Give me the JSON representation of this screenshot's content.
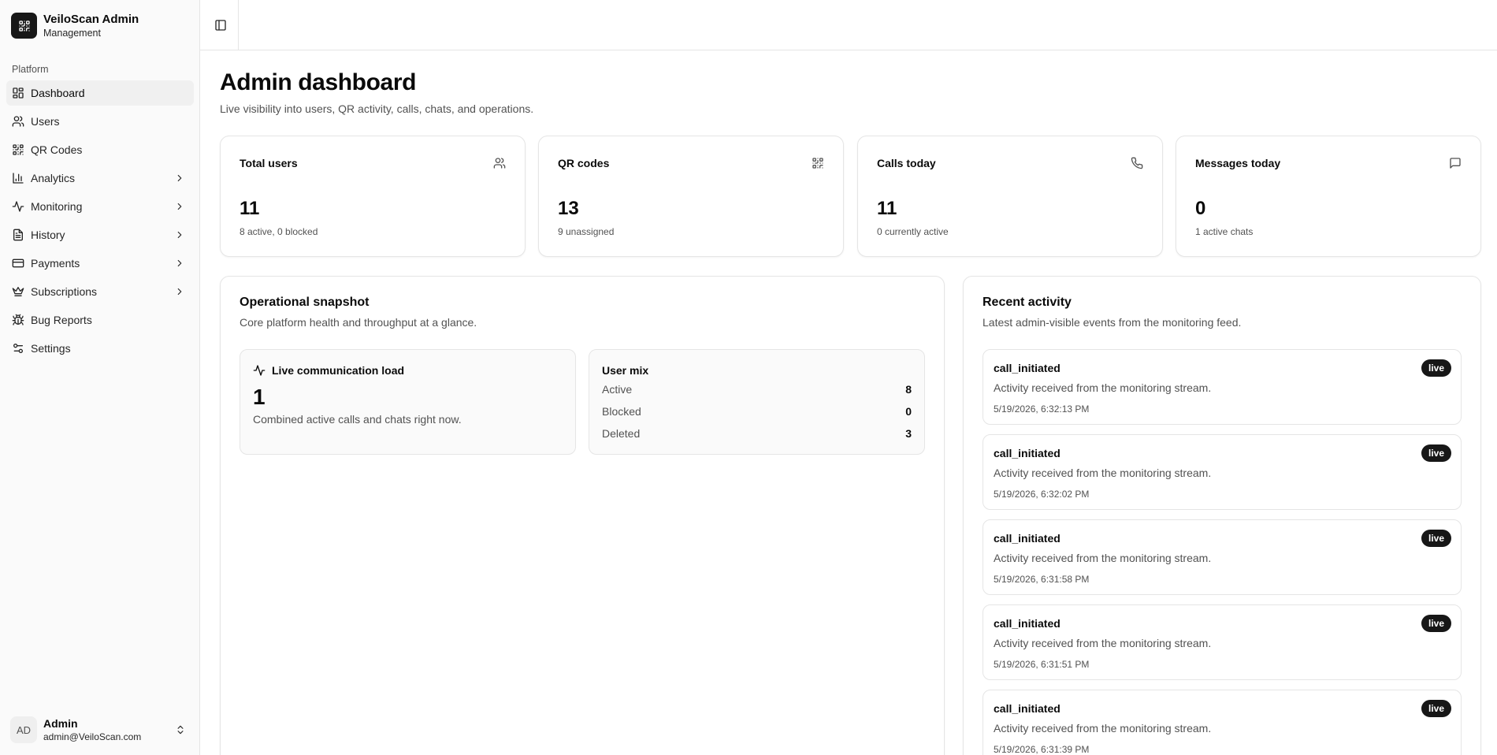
{
  "sidebar": {
    "brand_title": "VeiloScan Admin",
    "brand_subtitle": "Management",
    "group_label": "Platform",
    "items": [
      {
        "label": "Dashboard",
        "icon": "layout-dashboard-icon",
        "active": true,
        "has_submenu": false
      },
      {
        "label": "Users",
        "icon": "users-icon",
        "active": false,
        "has_submenu": false
      },
      {
        "label": "QR Codes",
        "icon": "qr-code-icon",
        "active": false,
        "has_submenu": false
      },
      {
        "label": "Analytics",
        "icon": "bar-chart-icon",
        "active": false,
        "has_submenu": true
      },
      {
        "label": "Monitoring",
        "icon": "activity-icon",
        "active": false,
        "has_submenu": true
      },
      {
        "label": "History",
        "icon": "file-text-icon",
        "active": false,
        "has_submenu": true
      },
      {
        "label": "Payments",
        "icon": "credit-card-icon",
        "active": false,
        "has_submenu": true
      },
      {
        "label": "Subscriptions",
        "icon": "crown-icon",
        "active": false,
        "has_submenu": true
      },
      {
        "label": "Bug Reports",
        "icon": "bug-icon",
        "active": false,
        "has_submenu": false
      },
      {
        "label": "Settings",
        "icon": "sliders-icon",
        "active": false,
        "has_submenu": false
      }
    ],
    "user": {
      "initials": "AD",
      "name": "Admin",
      "email": "admin@VeiloScan.com"
    }
  },
  "header": {
    "title": "Admin dashboard",
    "subtitle": "Live visibility into users, QR activity, calls, chats, and operations."
  },
  "stats": [
    {
      "title": "Total users",
      "value": "11",
      "note": "8 active, 0 blocked",
      "icon": "users-icon"
    },
    {
      "title": "QR codes",
      "value": "13",
      "note": "9 unassigned",
      "icon": "qr-code-icon"
    },
    {
      "title": "Calls today",
      "value": "11",
      "note": "0 currently active",
      "icon": "phone-icon"
    },
    {
      "title": "Messages today",
      "value": "0",
      "note": "1 active chats",
      "icon": "message-square-icon"
    }
  ],
  "snapshot": {
    "title": "Operational snapshot",
    "description": "Core platform health and throughput at a glance.",
    "load": {
      "title": "Live communication load",
      "value": "1",
      "description": "Combined active calls and chats right now."
    },
    "mix": {
      "title": "User mix",
      "rows": [
        {
          "label": "Active",
          "value": "8"
        },
        {
          "label": "Blocked",
          "value": "0"
        },
        {
          "label": "Deleted",
          "value": "3"
        }
      ]
    }
  },
  "activity": {
    "title": "Recent activity",
    "description": "Latest admin-visible events from the monitoring feed.",
    "items": [
      {
        "type": "call_initiated",
        "description": "Activity received from the monitoring stream.",
        "time": "5/19/2026, 6:32:13 PM",
        "badge": "live"
      },
      {
        "type": "call_initiated",
        "description": "Activity received from the monitoring stream.",
        "time": "5/19/2026, 6:32:02 PM",
        "badge": "live"
      },
      {
        "type": "call_initiated",
        "description": "Activity received from the monitoring stream.",
        "time": "5/19/2026, 6:31:58 PM",
        "badge": "live"
      },
      {
        "type": "call_initiated",
        "description": "Activity received from the monitoring stream.",
        "time": "5/19/2026, 6:31:51 PM",
        "badge": "live"
      },
      {
        "type": "call_initiated",
        "description": "Activity received from the monitoring stream.",
        "time": "5/19/2026, 6:31:39 PM",
        "badge": "live"
      }
    ]
  },
  "colors": {
    "primary": "#171717",
    "muted_text": "#525252",
    "border": "#e5e5e5",
    "sidebar_bg": "#fafafa"
  }
}
